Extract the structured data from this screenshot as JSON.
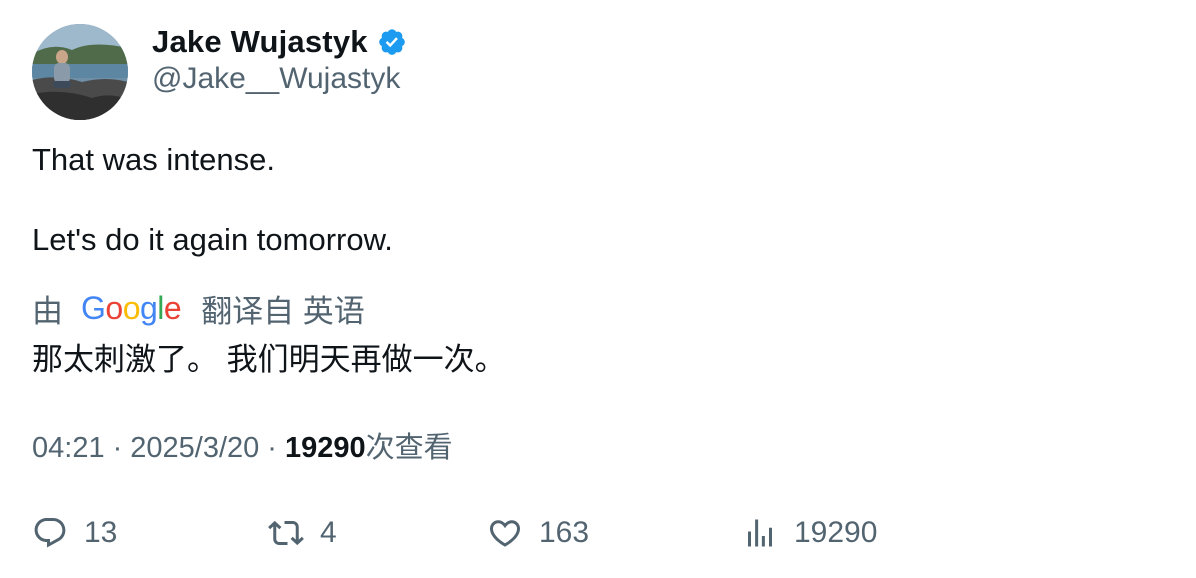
{
  "author": {
    "display_name": "Jake Wujastyk",
    "handle": "@Jake__Wujastyk",
    "verified": true,
    "verified_color": "#1d9bf0",
    "avatar_icon": "profile-photo"
  },
  "tweet": {
    "lines": [
      "That was intense.",
      "Let's do it again tomorrow."
    ]
  },
  "translation": {
    "prefix": "由",
    "provider_letters": [
      "G",
      "o",
      "o",
      "g",
      "l",
      "e"
    ],
    "label": "翻译自 英语",
    "text": "那太刺激了。 我们明天再做一次。"
  },
  "meta": {
    "time": "04:21",
    "separator": "·",
    "date": "2025/3/20",
    "views": "19290",
    "views_suffix": "次查看"
  },
  "actions": {
    "replies": {
      "icon": "reply-icon",
      "count": "13"
    },
    "retweets": {
      "icon": "retweet-icon",
      "count": "4"
    },
    "likes": {
      "icon": "heart-icon",
      "count": "163"
    },
    "views": {
      "icon": "analytics-icon",
      "count": "19290"
    }
  },
  "colors": {
    "text_primary": "#0f1419",
    "text_secondary": "#536471"
  }
}
